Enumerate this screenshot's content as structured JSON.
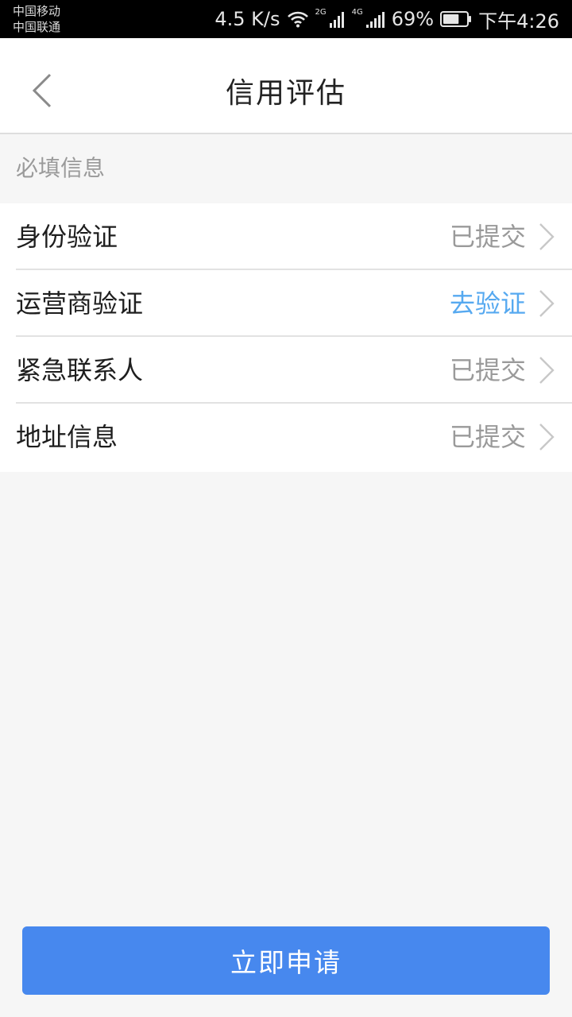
{
  "status_bar": {
    "carrier_1": "中国移动",
    "carrier_2": "中国联通",
    "net_speed": "4.5 K/s",
    "sim1_badge": "2G",
    "sim2_badge": "4G",
    "battery": "69%",
    "battery_level": 0.69,
    "time": "下午4:26"
  },
  "nav": {
    "title": "信用评估",
    "back_icon": "chevron-left-icon"
  },
  "section": {
    "header": "必填信息"
  },
  "items": [
    {
      "label": "身份验证",
      "status": "已提交",
      "state": "done"
    },
    {
      "label": "运营商验证",
      "status": "去验证",
      "state": "action"
    },
    {
      "label": "紧急联系人",
      "status": "已提交",
      "state": "done"
    },
    {
      "label": "地址信息",
      "status": "已提交",
      "state": "done"
    }
  ],
  "footer": {
    "apply_label": "立即申请"
  },
  "colors": {
    "primary": "#4788ee",
    "link": "#56a9f0",
    "muted": "#9a9a9a",
    "background": "#f6f6f6"
  }
}
